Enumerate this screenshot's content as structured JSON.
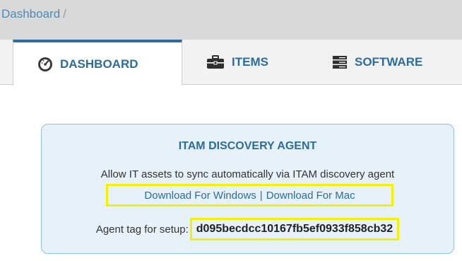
{
  "breadcrumb": {
    "label": "Dashboard",
    "separator": "/"
  },
  "tabs": [
    {
      "label": "DASHBOARD",
      "icon": "dashboard-gauge-icon",
      "active": true
    },
    {
      "label": "ITEMS",
      "icon": "briefcase-icon",
      "active": false
    },
    {
      "label": "SOFTWARE",
      "icon": "server-icon",
      "active": false
    }
  ],
  "agent_card": {
    "title": "ITAM DISCOVERY AGENT",
    "description": "Allow IT assets to sync automatically via ITAM discovery agent",
    "download_windows": "Download For Windows",
    "download_separator": "|",
    "download_mac": "Download For Mac",
    "tag_label": "Agent tag for setup:",
    "tag_value": "d095becdcc10167fb5ef0933f858cb32"
  },
  "colors": {
    "accent": "#2d6c9e",
    "card_background": "#e6f1fa",
    "card_border": "#8fc0e3",
    "highlight": "#f3f000",
    "breadcrumb_bar": "#d9d9d9"
  }
}
